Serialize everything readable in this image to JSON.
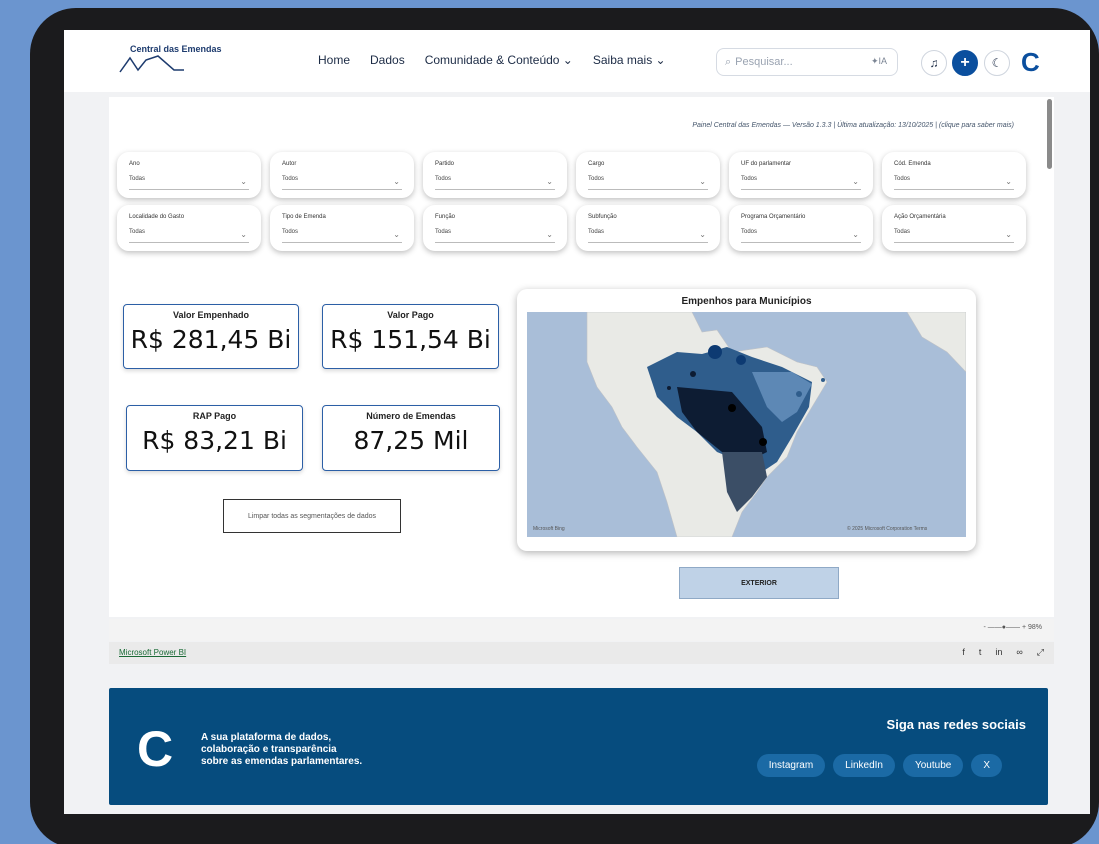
{
  "nav": {
    "logo_text": "Central das Emendas",
    "menu": [
      "Home",
      "Dados",
      "Comunidade & Conteúdo ⌄",
      "Saiba mais ⌄"
    ],
    "search_placeholder": "Pesquisar...",
    "search_ia": "✦IA"
  },
  "powerbi": {
    "version_text": "Painel Central das Emendas — Versão 1.3.3 | Última atualização: 13/10/2025 | (clique para saber mais)",
    "slicers": [
      {
        "label": "Ano",
        "value": "Todas"
      },
      {
        "label": "Autor",
        "value": "Todos"
      },
      {
        "label": "Partido",
        "value": "Todos"
      },
      {
        "label": "Cargo",
        "value": "Todos"
      },
      {
        "label": "UF do parlamentar",
        "value": "Todos"
      },
      {
        "label": "Cód. Emenda",
        "value": "Todos"
      },
      {
        "label": "Localidade do Gasto",
        "value": "Todas"
      },
      {
        "label": "Tipo de Emenda",
        "value": "Todos"
      },
      {
        "label": "Função",
        "value": "Todas"
      },
      {
        "label": "Subfunção",
        "value": "Todas"
      },
      {
        "label": "Programa Orçamentário",
        "value": "Todos"
      },
      {
        "label": "Ação Orçamentária",
        "value": "Todas"
      }
    ],
    "cards": {
      "valor_empenhado": {
        "title": "Valor Empenhado",
        "value": "R$ 281,45 Bi"
      },
      "valor_pago": {
        "title": "Valor Pago",
        "value": "R$ 151,54 Bi"
      },
      "rap_pago": {
        "title": "RAP Pago",
        "value": "R$ 83,21 Bi"
      },
      "numero_emendas": {
        "title": "Número de Emendas",
        "value": "87,25 Mil"
      }
    },
    "clear_button": "Limpar todas as segmentações de dados",
    "map": {
      "title": "Empenhos para Municípios",
      "bing_label": "Microsoft Bing",
      "copyright": "© 2025 Microsoft Corporation  Terms"
    },
    "exterior_button": "EXTERIOR",
    "zoom": "- ——●—— +  98%",
    "link": "Microsoft Power BI"
  },
  "footer": {
    "tagline": [
      "A sua plataforma de dados,",
      "colaboração e transparência",
      "sobre as emendas parlamentares."
    ],
    "follow": "Siga nas redes sociais",
    "socials": [
      "Instagram",
      "LinkedIn",
      "Youtube",
      "X"
    ]
  }
}
